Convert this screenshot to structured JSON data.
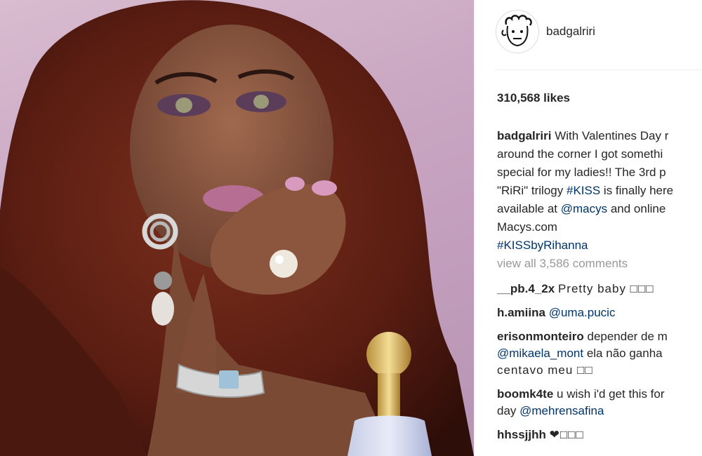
{
  "post": {
    "username": "badgalriri",
    "likes": "310,568 likes",
    "caption": {
      "author": "badgalriri",
      "line1": "With Valentines Day r",
      "line2": "around the corner I got somethi",
      "line3": "special for my ladies!! The 3rd p",
      "line4_pre": "\"RiRi\" trilogy ",
      "line4_tag": "#KISS",
      "line4_post": " is finally here",
      "line5_pre": "available at ",
      "line5_mention": "@macys",
      "line5_post": " and online",
      "line6": "Macys.com",
      "line7_tag": "#KISSbyRihanna"
    },
    "view_all": "view all 3,586 comments"
  },
  "comments": [
    {
      "user": "__pb.4_2x",
      "text": "Pretty baby □□□"
    },
    {
      "user": "h.amiina",
      "mention": "@uma.pucic"
    },
    {
      "user": "erisonmonteiro",
      "text": "depender de m",
      "mention": "@mikaela_mont",
      "text2": "ela não ganha",
      "text3": "centavo meu □□"
    },
    {
      "user": "boomk4te",
      "text": "u wish i'd get this for",
      "text2": "day ",
      "mention": "@mehrensafina"
    },
    {
      "user": "hhssjjhh",
      "text": "❤□□□"
    }
  ],
  "icons": {
    "avatar": "cartoon-face-avatar-icon"
  }
}
